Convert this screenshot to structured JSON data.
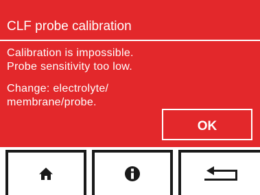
{
  "dialog": {
    "title": "CLF probe calibration",
    "message_lines": [
      "Calibration is impossible.",
      "Probe sensitivity too low.",
      "Change: electrolyte/",
      "membrane/probe."
    ],
    "ok_label": "OK",
    "background_color": "#e3282b"
  },
  "toolbar": {
    "buttons": [
      {
        "icon": "home-icon"
      },
      {
        "icon": "info-icon"
      },
      {
        "icon": "return-arrow-icon"
      }
    ]
  }
}
